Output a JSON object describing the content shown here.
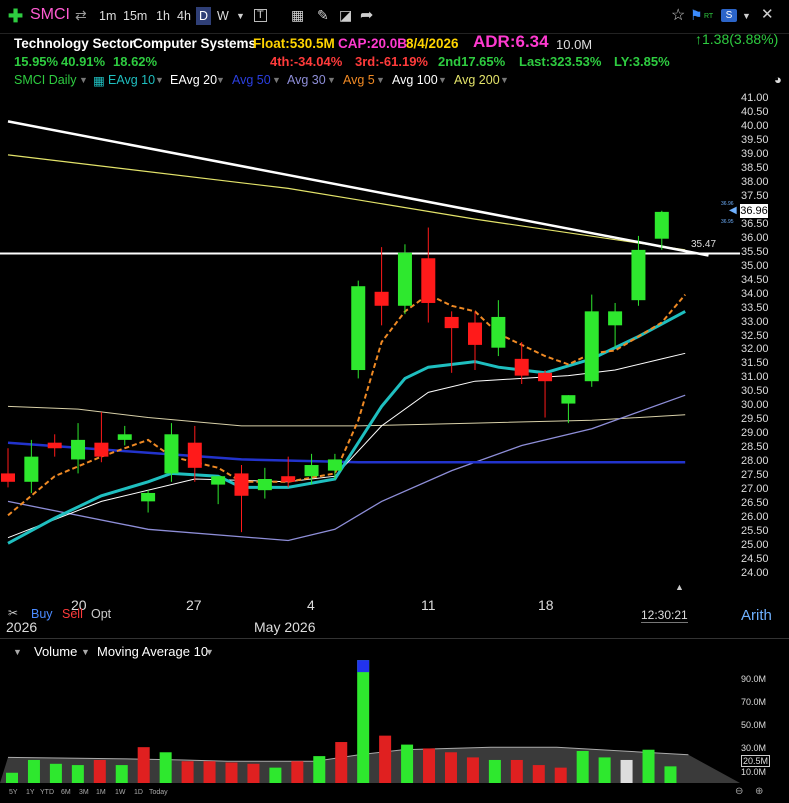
{
  "toolbar": {
    "plus_icon": "plus-icon",
    "ticker": "SMCI",
    "timeframes": [
      "1m",
      "15m",
      "1h",
      "4h",
      "D",
      "W"
    ],
    "active_timeframe": "D",
    "dropdown_icon": "▼",
    "tools": [
      "text-tool-icon",
      "grid-icon",
      "pencil-icon",
      "eraser-icon",
      "share-arrow-icon"
    ],
    "right_tools": [
      "star-icon",
      "rt-flag-icon",
      "s-icon",
      "dropdown-icon",
      "close-icon"
    ],
    "rt_label": "RT",
    "s_label": "S"
  },
  "info": {
    "sector": "Technology Sector",
    "industry": "Computer Systems",
    "float": "Float:530.5M",
    "cap": "CAP:20.0B",
    "date": "8/4/2026",
    "adr": "ADR:6.34",
    "volume": "10.0M",
    "change": "↑1.38(3.88%)",
    "row2": {
      "p1": "15.95%",
      "p2": "40.91%",
      "p3": "18.62%",
      "fourth": "4th:-34.04%",
      "third": "3rd:-61.19%",
      "second": "2nd17.65%",
      "last": "Last:323.53%",
      "ly": "LY:3.85%"
    }
  },
  "legend": {
    "symbol": "SMCI Daily",
    "items": [
      {
        "label": "EAvg 10",
        "color": "#1fbfc0"
      },
      {
        "label": "EAvg 20",
        "color": "#ffffff"
      },
      {
        "label": "Avg 50",
        "color": "#2233cc"
      },
      {
        "label": "Avg 30",
        "color": "#8e8ed8"
      },
      {
        "label": "Avg 5",
        "color": "#f08a24"
      },
      {
        "label": "Avg 100",
        "color": "#ffffff"
      },
      {
        "label": "Avg 200",
        "color": "#e3e36a"
      }
    ]
  },
  "price_axis": {
    "labels": [
      "41.00",
      "40.50",
      "40.00",
      "39.50",
      "39.00",
      "38.50",
      "38.00",
      "37.50",
      "37.00",
      "36.50",
      "36.00",
      "35.50",
      "35.00",
      "34.50",
      "34.00",
      "33.50",
      "33.00",
      "32.50",
      "32.00",
      "31.50",
      "31.00",
      "30.50",
      "30.00",
      "29.50",
      "29.00",
      "28.50",
      "28.00",
      "27.50",
      "27.00",
      "26.50",
      "26.00",
      "25.50",
      "25.00",
      "24.50",
      "24.00"
    ],
    "last_price": "36.96",
    "mini_price_a": "36.96",
    "mini_price_b": "36.95",
    "hline_label": "35.47",
    "scale_mode": "Arith",
    "clock": "12:30:21"
  },
  "time_axis": {
    "dates": [
      "20",
      "27",
      "4",
      "11",
      "18"
    ],
    "year_left": "2026",
    "month_label": "May 2026"
  },
  "order_buttons": {
    "buy": "Buy",
    "sell": "Sell",
    "opt": "Opt"
  },
  "volume_panel": {
    "title": "Volume",
    "ma_label": "Moving Average 10",
    "axis": [
      "90.0M",
      "70.0M",
      "50.0M",
      "30.0M",
      "20.5M",
      "10.0M"
    ]
  },
  "range_bar": [
    "5Y",
    "1Y",
    "YTD",
    "6M",
    "3M",
    "1M",
    "1W",
    "1D",
    "Today"
  ],
  "chart_data": {
    "type": "candlestick",
    "ylim": [
      24.0,
      41.0
    ],
    "candles": [
      {
        "o": 27.6,
        "h": 28.5,
        "l": 27.1,
        "c": 27.3
      },
      {
        "o": 27.3,
        "h": 28.8,
        "l": 26.9,
        "c": 28.2
      },
      {
        "o": 28.7,
        "h": 29.0,
        "l": 28.2,
        "c": 28.5
      },
      {
        "o": 28.1,
        "h": 29.4,
        "l": 27.6,
        "c": 28.8
      },
      {
        "o": 28.7,
        "h": 29.8,
        "l": 28.0,
        "c": 28.2
      },
      {
        "o": 28.8,
        "h": 29.3,
        "l": 28.6,
        "c": 29.0
      },
      {
        "o": 26.6,
        "h": 27.0,
        "l": 26.2,
        "c": 26.9
      },
      {
        "o": 27.6,
        "h": 29.4,
        "l": 27.3,
        "c": 29.0
      },
      {
        "o": 28.7,
        "h": 29.3,
        "l": 27.3,
        "c": 27.8
      },
      {
        "o": 27.2,
        "h": 27.5,
        "l": 26.5,
        "c": 27.5
      },
      {
        "o": 27.6,
        "h": 27.9,
        "l": 25.5,
        "c": 26.8
      },
      {
        "o": 27.0,
        "h": 27.8,
        "l": 26.7,
        "c": 27.4
      },
      {
        "o": 27.5,
        "h": 28.2,
        "l": 27.1,
        "c": 27.3
      },
      {
        "o": 27.5,
        "h": 28.3,
        "l": 27.2,
        "c": 27.9
      },
      {
        "o": 27.7,
        "h": 28.3,
        "l": 27.4,
        "c": 28.1
      },
      {
        "o": 31.3,
        "h": 34.5,
        "l": 31.0,
        "c": 34.3
      },
      {
        "o": 34.1,
        "h": 35.7,
        "l": 32.9,
        "c": 33.6
      },
      {
        "o": 33.6,
        "h": 35.8,
        "l": 33.3,
        "c": 35.5
      },
      {
        "o": 35.3,
        "h": 36.4,
        "l": 33.0,
        "c": 33.7
      },
      {
        "o": 33.2,
        "h": 33.4,
        "l": 31.2,
        "c": 32.8
      },
      {
        "o": 33.0,
        "h": 33.4,
        "l": 31.3,
        "c": 32.2
      },
      {
        "o": 32.1,
        "h": 33.8,
        "l": 31.8,
        "c": 33.2
      },
      {
        "o": 31.7,
        "h": 32.3,
        "l": 30.8,
        "c": 31.1
      },
      {
        "o": 31.2,
        "h": 31.3,
        "l": 29.6,
        "c": 30.9
      },
      {
        "o": 30.1,
        "h": 30.4,
        "l": 29.4,
        "c": 30.4
      },
      {
        "o": 30.9,
        "h": 34.0,
        "l": 30.7,
        "c": 33.4
      },
      {
        "o": 32.9,
        "h": 33.7,
        "l": 32.1,
        "c": 33.4
      },
      {
        "o": 33.8,
        "h": 36.1,
        "l": 33.6,
        "c": 35.6
      },
      {
        "o": 36.0,
        "h": 37.0,
        "l": 35.6,
        "c": 36.96
      }
    ],
    "lines": {
      "trend_white": [
        [
          0,
          40.2
        ],
        [
          30,
          35.4
        ]
      ],
      "hline": 35.47,
      "avg200": [
        [
          0,
          39.0
        ],
        [
          12,
          37.8
        ],
        [
          20,
          36.7
        ],
        [
          29,
          35.6
        ]
      ],
      "ema10": [
        [
          0,
          25.1
        ],
        [
          2,
          26.0
        ],
        [
          4,
          26.8
        ],
        [
          6,
          27.3
        ],
        [
          7,
          27.6
        ],
        [
          9,
          27.5
        ],
        [
          10,
          27.1
        ],
        [
          12,
          27.1
        ],
        [
          14,
          27.4
        ],
        [
          16,
          30.0
        ],
        [
          17,
          31.0
        ],
        [
          18,
          31.4
        ],
        [
          20,
          31.6
        ],
        [
          21,
          31.4
        ],
        [
          23,
          31.2
        ],
        [
          25,
          31.7
        ],
        [
          27,
          32.5
        ],
        [
          29,
          33.4
        ]
      ],
      "avg5": [
        [
          0,
          26.1
        ],
        [
          2,
          27.5
        ],
        [
          4,
          28.2
        ],
        [
          6,
          28.8
        ],
        [
          7,
          28.2
        ],
        [
          9,
          27.8
        ],
        [
          10,
          27.3
        ],
        [
          12,
          27.3
        ],
        [
          14,
          27.6
        ],
        [
          15,
          29.5
        ],
        [
          16,
          32.3
        ],
        [
          17,
          33.4
        ],
        [
          18,
          34.0
        ],
        [
          19,
          33.6
        ],
        [
          20,
          33.4
        ],
        [
          21,
          32.6
        ],
        [
          23,
          31.8
        ],
        [
          24,
          31.5
        ],
        [
          25,
          31.9
        ],
        [
          26,
          32.0
        ],
        [
          28,
          33.0
        ],
        [
          29,
          34.0
        ]
      ],
      "ema20": [
        [
          0,
          25.3
        ],
        [
          4,
          26.6
        ],
        [
          8,
          27.4
        ],
        [
          12,
          27.3
        ],
        [
          14,
          27.5
        ],
        [
          16,
          29.3
        ],
        [
          18,
          30.5
        ],
        [
          20,
          30.9
        ],
        [
          22,
          31.0
        ],
        [
          24,
          31.1
        ],
        [
          26,
          31.3
        ],
        [
          28,
          31.7
        ],
        [
          29,
          31.9
        ]
      ],
      "avg100": [
        [
          0,
          30.0
        ],
        [
          3,
          29.9
        ],
        [
          6,
          29.6
        ],
        [
          10,
          29.3
        ],
        [
          15,
          29.3
        ],
        [
          20,
          29.4
        ],
        [
          25,
          29.5
        ],
        [
          29,
          29.7
        ]
      ],
      "avg50": [
        [
          0,
          28.7
        ],
        [
          5,
          28.4
        ],
        [
          10,
          28.1
        ],
        [
          15,
          28.0
        ],
        [
          20,
          28.0
        ],
        [
          25,
          28.0
        ],
        [
          29,
          28.0
        ]
      ],
      "avg30": [
        [
          0,
          26.6
        ],
        [
          6,
          25.6
        ],
        [
          12,
          25.2
        ],
        [
          14,
          25.6
        ],
        [
          16,
          26.6
        ],
        [
          19,
          27.7
        ],
        [
          22,
          28.6
        ],
        [
          25,
          29.2
        ],
        [
          29,
          30.4
        ]
      ]
    },
    "volume": {
      "ylim": [
        0,
        100
      ],
      "values": [
        [
          8,
          "g"
        ],
        [
          18,
          "g"
        ],
        [
          15,
          "g"
        ],
        [
          14,
          "g"
        ],
        [
          18,
          "r"
        ],
        [
          14,
          "g"
        ],
        [
          28,
          "r"
        ],
        [
          24,
          "g"
        ],
        [
          17,
          "r"
        ],
        [
          17,
          "r"
        ],
        [
          16,
          "r"
        ],
        [
          15,
          "r"
        ],
        [
          12,
          "g"
        ],
        [
          17,
          "r"
        ],
        [
          21,
          "g"
        ],
        [
          32,
          "r"
        ],
        [
          96,
          "g"
        ],
        [
          37,
          "r"
        ],
        [
          30,
          "g"
        ],
        [
          27,
          "r"
        ],
        [
          24,
          "r"
        ],
        [
          20,
          "r"
        ],
        [
          18,
          "g"
        ],
        [
          18,
          "r"
        ],
        [
          14,
          "r"
        ],
        [
          12,
          "r"
        ],
        [
          25,
          "g"
        ],
        [
          20,
          "g"
        ],
        [
          18,
          "w"
        ],
        [
          26,
          "g"
        ],
        [
          13,
          "g"
        ]
      ],
      "ma10": [
        [
          0,
          20
        ],
        [
          5,
          19
        ],
        [
          8,
          18
        ],
        [
          10,
          17
        ],
        [
          14,
          17
        ],
        [
          16,
          22
        ],
        [
          18,
          26
        ],
        [
          22,
          28
        ],
        [
          25,
          28
        ],
        [
          28,
          25
        ],
        [
          31,
          22
        ]
      ]
    }
  }
}
